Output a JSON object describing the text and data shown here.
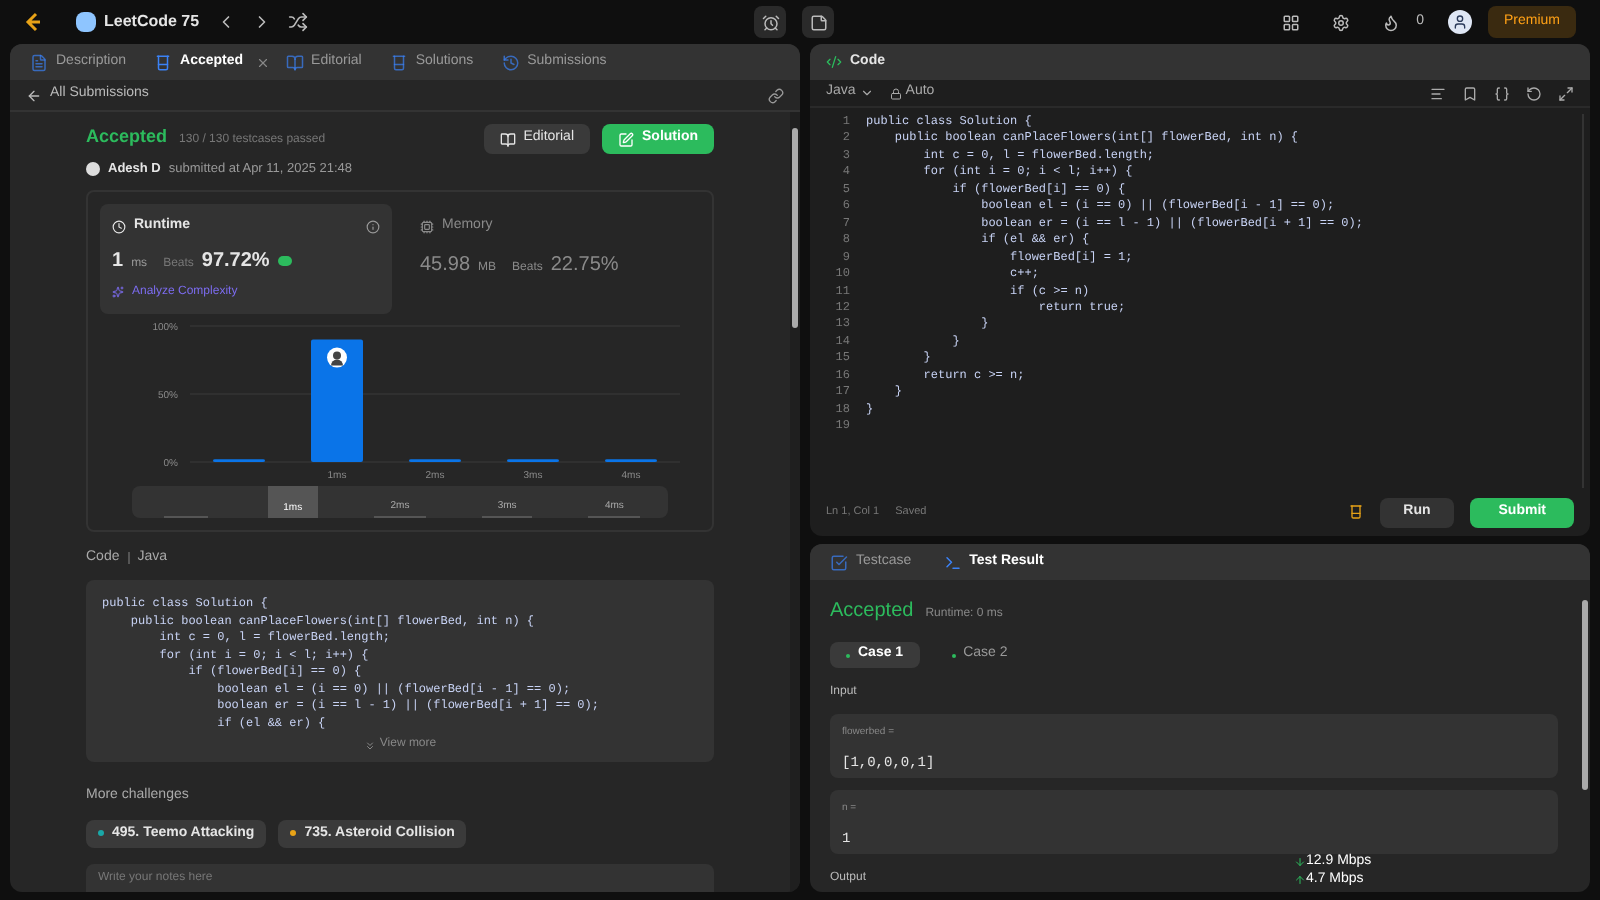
{
  "topbar": {
    "list_title": "LeetCode 75",
    "streak": "0",
    "premium": "Premium"
  },
  "left_tabs": [
    {
      "label": "Description",
      "selected": false,
      "closable": false
    },
    {
      "label": "Accepted",
      "selected": true,
      "closable": true
    },
    {
      "label": "Editorial",
      "selected": false,
      "closable": false
    },
    {
      "label": "Solutions",
      "selected": false,
      "closable": false
    },
    {
      "label": "Submissions",
      "selected": false,
      "closable": false
    }
  ],
  "back_link": "All Submissions",
  "submission": {
    "status": "Accepted",
    "tests": "130 / 130 testcases passed",
    "user": "Adesh D",
    "submitted": "submitted at Apr 11, 2025 21:48",
    "buttons": [
      "Editorial",
      "Solution"
    ]
  },
  "runtime": {
    "label": "Runtime",
    "value": "1",
    "unit": "ms",
    "beats_label": "Beats",
    "beats": "97.72%",
    "analyze": "Analyze Complexity",
    "selected": true
  },
  "memory": {
    "label": "Memory",
    "value": "45.98",
    "unit": "MB",
    "beats_label": "Beats",
    "beats": "22.75%",
    "selected": false
  },
  "chart_data": {
    "type": "bar",
    "categories": [
      null,
      "1ms",
      "2ms",
      "3ms",
      "4ms"
    ],
    "values": [
      2,
      90,
      2,
      2,
      2
    ],
    "ylim": [
      0,
      100
    ],
    "yticks": [
      {
        "value": 0,
        "label": "0%"
      },
      {
        "value": 50,
        "label": "50%"
      },
      {
        "value": 100,
        "label": "100%"
      }
    ]
  },
  "navigator": [
    {
      "selected": false
    },
    {
      "label": "1ms",
      "selected": true
    },
    {
      "label": "2ms",
      "selected": false
    },
    {
      "label": "3ms",
      "selected": false
    },
    {
      "label": "4ms",
      "selected": false
    }
  ],
  "code_preview": {
    "label": "Code",
    "language": "Java",
    "lines": [
      "public class Solution {",
      "    public boolean canPlaceFlowers(int[] flowerBed, int n) {",
      "        int c = 0, l = flowerBed.length;",
      "        for (int i = 0; i < l; i++) {",
      "            if (flowerBed[i] == 0) {",
      "                boolean el = (i == 0) || (flowerBed[i - 1] == 0);",
      "                boolean er = (i == l - 1) || (flowerBed[i + 1] == 0);",
      "                if (el && er) {"
    ],
    "view_more": "View more"
  },
  "more_challenges": {
    "title": "More challenges",
    "items": [
      {
        "label": "495. Teemo Attacking",
        "color": "#1aa8a8"
      },
      {
        "label": "735. Asteroid Collision",
        "color": "#e8a317"
      }
    ]
  },
  "notes": {
    "placeholder": "Write your notes here"
  },
  "editor": {
    "title": "Code",
    "language": "Java",
    "mode": "Auto",
    "lines": [
      "public class Solution {",
      "    public boolean canPlaceFlowers(int[] flowerBed, int n) {",
      "        int c = 0, l = flowerBed.length;",
      "        for (int i = 0; i < l; i++) {",
      "            if (flowerBed[i] == 0) {",
      "                boolean el = (i == 0) || (flowerBed[i - 1] == 0);",
      "                boolean er = (i == l - 1) || (flowerBed[i + 1] == 0);",
      "                if (el && er) {",
      "                    flowerBed[i] = 1;",
      "                    c++;",
      "                    if (c >= n)",
      "                        return true;",
      "                }",
      "            }",
      "        }",
      "        return c >= n;",
      "    }",
      "}"
    ],
    "line_numbers": [
      "1",
      "2",
      "3",
      "4",
      "5",
      "6",
      "7",
      "8",
      "9",
      "10",
      "11",
      "12",
      "13",
      "14",
      "15",
      "16",
      "17",
      "18",
      "19"
    ],
    "status": "Ln 1, Col 1",
    "saved": "Saved",
    "run": "Run",
    "submit": "Submit"
  },
  "result_tabs": [
    {
      "label": "Testcase",
      "selected": false
    },
    {
      "label": "Test Result",
      "selected": true
    }
  ],
  "result": {
    "status": "Accepted",
    "runtime": "Runtime: 0 ms",
    "cases": [
      {
        "label": "Case 1",
        "selected": true
      },
      {
        "label": "Case 2",
        "selected": false
      }
    ],
    "input_label": "Input",
    "inputs": [
      {
        "name": "flowerbed =",
        "value": "[1,0,0,0,1]"
      },
      {
        "name": "n =",
        "value": "1"
      }
    ],
    "output_label": "Output"
  },
  "network_overlay": [
    "12.9 Mbps",
    "4.7 Mbps"
  ]
}
